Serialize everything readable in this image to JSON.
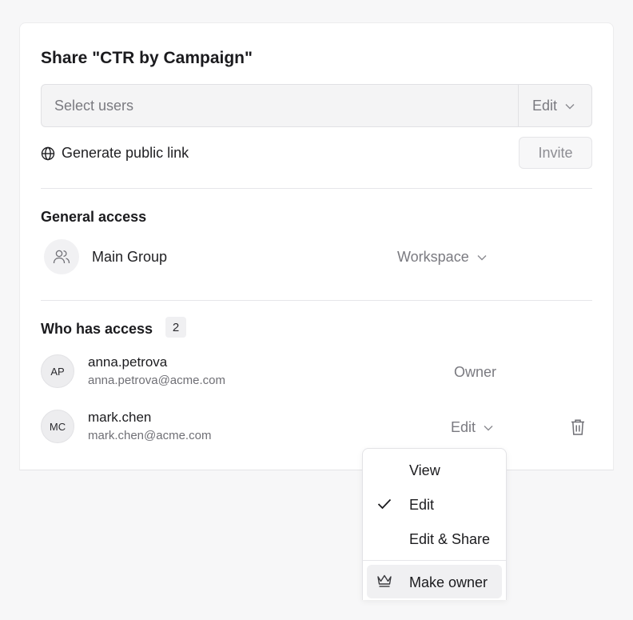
{
  "dialog": {
    "title": "Share \"CTR by Campaign\"",
    "select_placeholder": "Select users",
    "select_permission": "Edit",
    "public_link_label": "Generate public link",
    "invite_label": "Invite"
  },
  "general_access": {
    "heading": "General access",
    "group_name": "Main Group",
    "scope": "Workspace"
  },
  "who_has_access": {
    "heading": "Who has access",
    "count": "2",
    "users": [
      {
        "initials": "AP",
        "name": "anna.petrova",
        "email": "anna.petrova@acme.com",
        "role": "Owner"
      },
      {
        "initials": "MC",
        "name": "mark.chen",
        "email": "mark.chen@acme.com",
        "role": "Edit"
      }
    ]
  },
  "role_menu": {
    "items": [
      "View",
      "Edit",
      "Edit & Share"
    ],
    "selected": "Edit",
    "make_owner": "Make owner"
  },
  "icons": {
    "globe": "globe-icon",
    "group": "users-icon",
    "chevron": "chevron-down-icon",
    "trash": "trash-icon",
    "check": "check-icon",
    "crown": "crown-icon"
  }
}
